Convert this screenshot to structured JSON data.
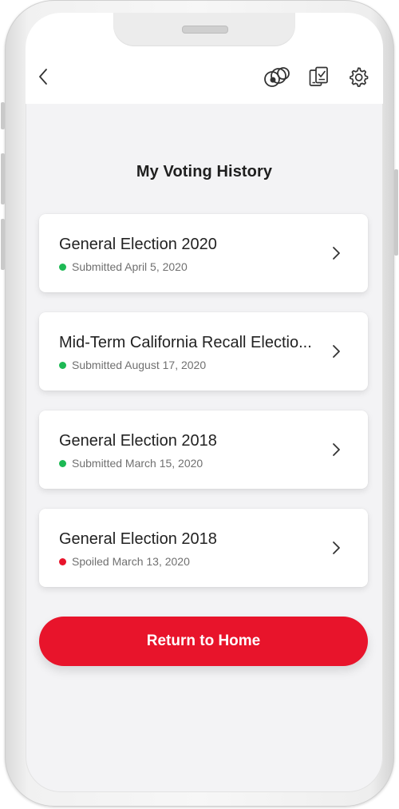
{
  "header": {
    "back_icon": "chevron-left-icon",
    "icons": [
      "connection-circles-icon",
      "documents-icon",
      "gear-icon"
    ]
  },
  "page": {
    "title": "My Voting History"
  },
  "history": [
    {
      "title": "General Election 2020",
      "status": "Submitted April 5, 2020",
      "status_color": "#1db954"
    },
    {
      "title": "Mid-Term California Recall Electio...",
      "status": "Submitted August 17, 2020",
      "status_color": "#1db954"
    },
    {
      "title": "General Election 2018",
      "status": "Submitted March 15, 2020",
      "status_color": "#1db954"
    },
    {
      "title": "General Election 2018",
      "status": "Spoiled March 13, 2020",
      "status_color": "#e8142b"
    }
  ],
  "actions": {
    "home_label": "Return to Home"
  },
  "theme": {
    "accent": "#e8142b",
    "success": "#1db954"
  }
}
